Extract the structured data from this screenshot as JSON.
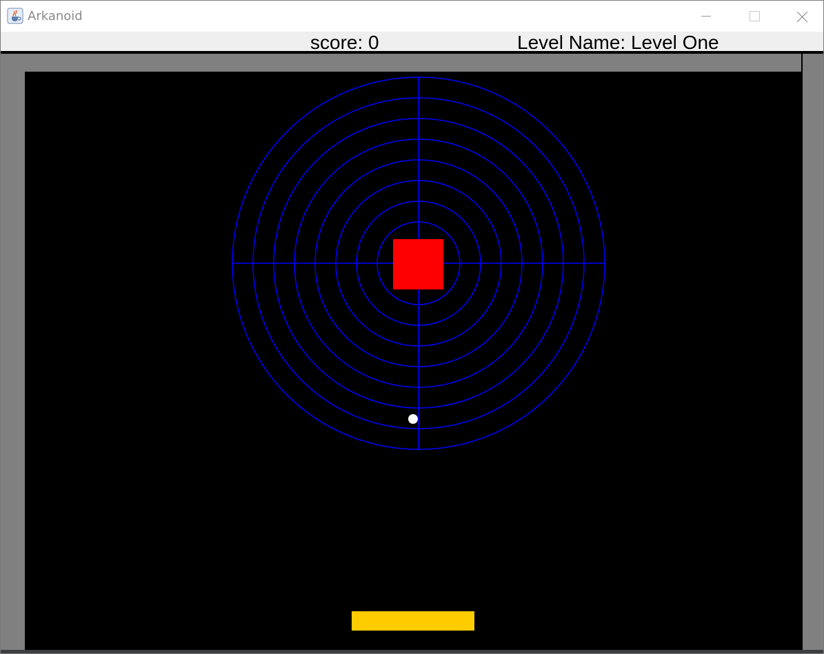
{
  "window": {
    "title": "Arkanoid",
    "icon": "java-cup-icon",
    "controls": {
      "minimize_icon": "minimize-icon",
      "maximize_icon": "maximize-icon",
      "close_icon": "close-icon"
    }
  },
  "hud": {
    "score_text": "score: 0",
    "level_text": "Level Name: Level One",
    "background_color": "#efefef"
  },
  "level": {
    "background_color": "#000000",
    "wall_color": "#808080",
    "target_rings": 9,
    "target_color": "#0000ff",
    "block": {
      "color": "#ff0000"
    },
    "ball": {
      "color": "#ffffff"
    },
    "paddle": {
      "color": "#ffcc00"
    }
  }
}
